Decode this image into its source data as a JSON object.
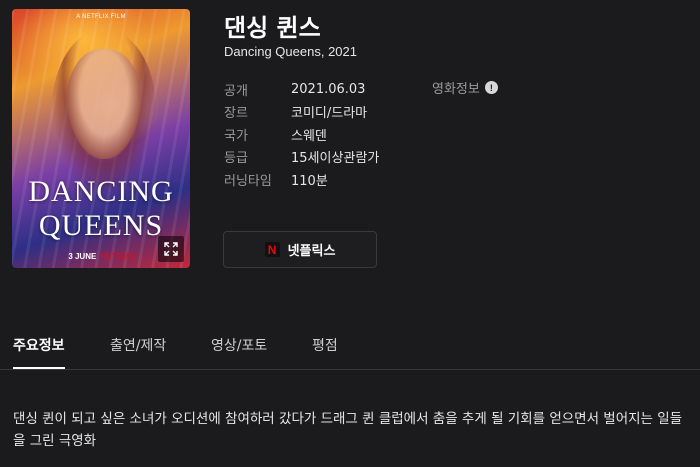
{
  "poster": {
    "top_text": "A NETFLIX FILM",
    "title_line1": "DANCING",
    "title_line2": "QUEENS",
    "release": "3 JUNE",
    "brand": "NETFLIX",
    "expand_icon": "expand-icon"
  },
  "title": "댄싱 퀸스",
  "subtitle": "Dancing Queens, 2021",
  "info": [
    {
      "label": "공개",
      "value": "2021.06.03"
    },
    {
      "label": "장르",
      "value": "코미디/드라마"
    },
    {
      "label": "국가",
      "value": "스웨덴"
    },
    {
      "label": "등급",
      "value": "15세이상관람가"
    },
    {
      "label": "러닝타임",
      "value": "110분"
    }
  ],
  "more_info": {
    "label": "영화정보",
    "icon": "!"
  },
  "watch_button": {
    "logo": "N",
    "label": "넷플릭스"
  },
  "tabs": [
    {
      "label": "주요정보",
      "active": true
    },
    {
      "label": "출연/제작",
      "active": false
    },
    {
      "label": "영상/포토",
      "active": false
    },
    {
      "label": "평점",
      "active": false
    }
  ],
  "synopsis": "댄싱 퀸이 되고 싶은 소녀가 오디션에 참여하러 갔다가 드래그 퀸 클럽에서 춤을 추게 될 기회를 얻으면서 벌어지는 일들을 그린 극영화",
  "colors": {
    "background": "#1b1b1d",
    "netflix_red": "#e50914",
    "muted": "#9a9a9a"
  }
}
